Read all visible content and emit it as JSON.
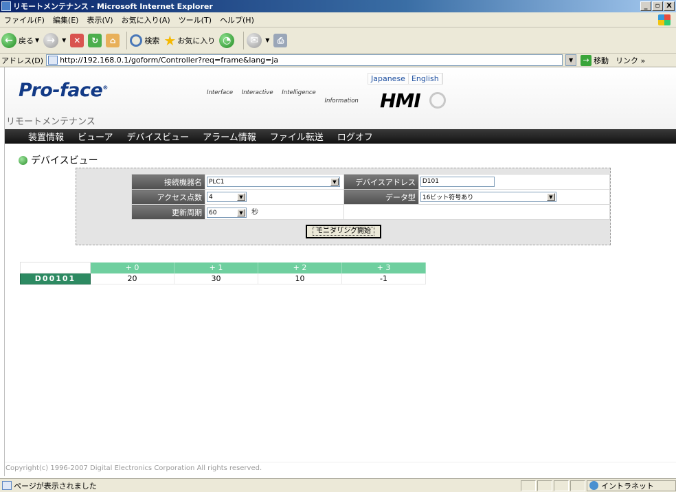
{
  "window": {
    "title": "リモートメンテナンス - Microsoft Internet Explorer",
    "buttons": [
      "_",
      "▫",
      "X"
    ]
  },
  "menu": [
    "ファイル(F)",
    "編集(E)",
    "表示(V)",
    "お気に入り(A)",
    "ツール(T)",
    "ヘルプ(H)"
  ],
  "toolbar": {
    "back": "戻る",
    "search": "検索",
    "favorites": "お気に入り"
  },
  "address": {
    "label": "アドレス(D)",
    "url": "http://192.168.0.1/goform/Controller?req=frame&lang=ja",
    "go": "移動",
    "links": "リンク »"
  },
  "header": {
    "languages": [
      "Japanese",
      "English"
    ],
    "logo": "Pro-face",
    "tagline": [
      "Interface",
      "Interactive",
      "Intelligence",
      "Information"
    ],
    "hmi": "HMI",
    "site_title": "リモートメンテナンス"
  },
  "nav": [
    "装置情報",
    "ビューア",
    "デバイスビュー",
    "アラーム情報",
    "ファイル転送",
    "ログオフ"
  ],
  "section_title": "デバイスビュー",
  "form": {
    "device_label": "接続機器名",
    "device_value": "PLC1",
    "address_label": "デバイスアドレス",
    "address_value": "D101",
    "count_label": "アクセス点数",
    "count_value": "4",
    "type_label": "データ型",
    "type_value": "16ビット符号あり",
    "cycle_label": "更新周期",
    "cycle_value": "60",
    "cycle_unit": "秒",
    "start_button": "モニタリング開始"
  },
  "data_table": {
    "headers": [
      "+ 0",
      "+ 1",
      "+ 2",
      "+ 3"
    ],
    "rows": [
      {
        "address": "D00101",
        "values": [
          "20",
          "30",
          "10",
          "-1"
        ]
      }
    ]
  },
  "footer": "Copyright(c) 1996-2007 Digital Electronics Corporation All rights reserved.",
  "status": {
    "text": "ページが表示されました",
    "zone": "イントラネット"
  }
}
